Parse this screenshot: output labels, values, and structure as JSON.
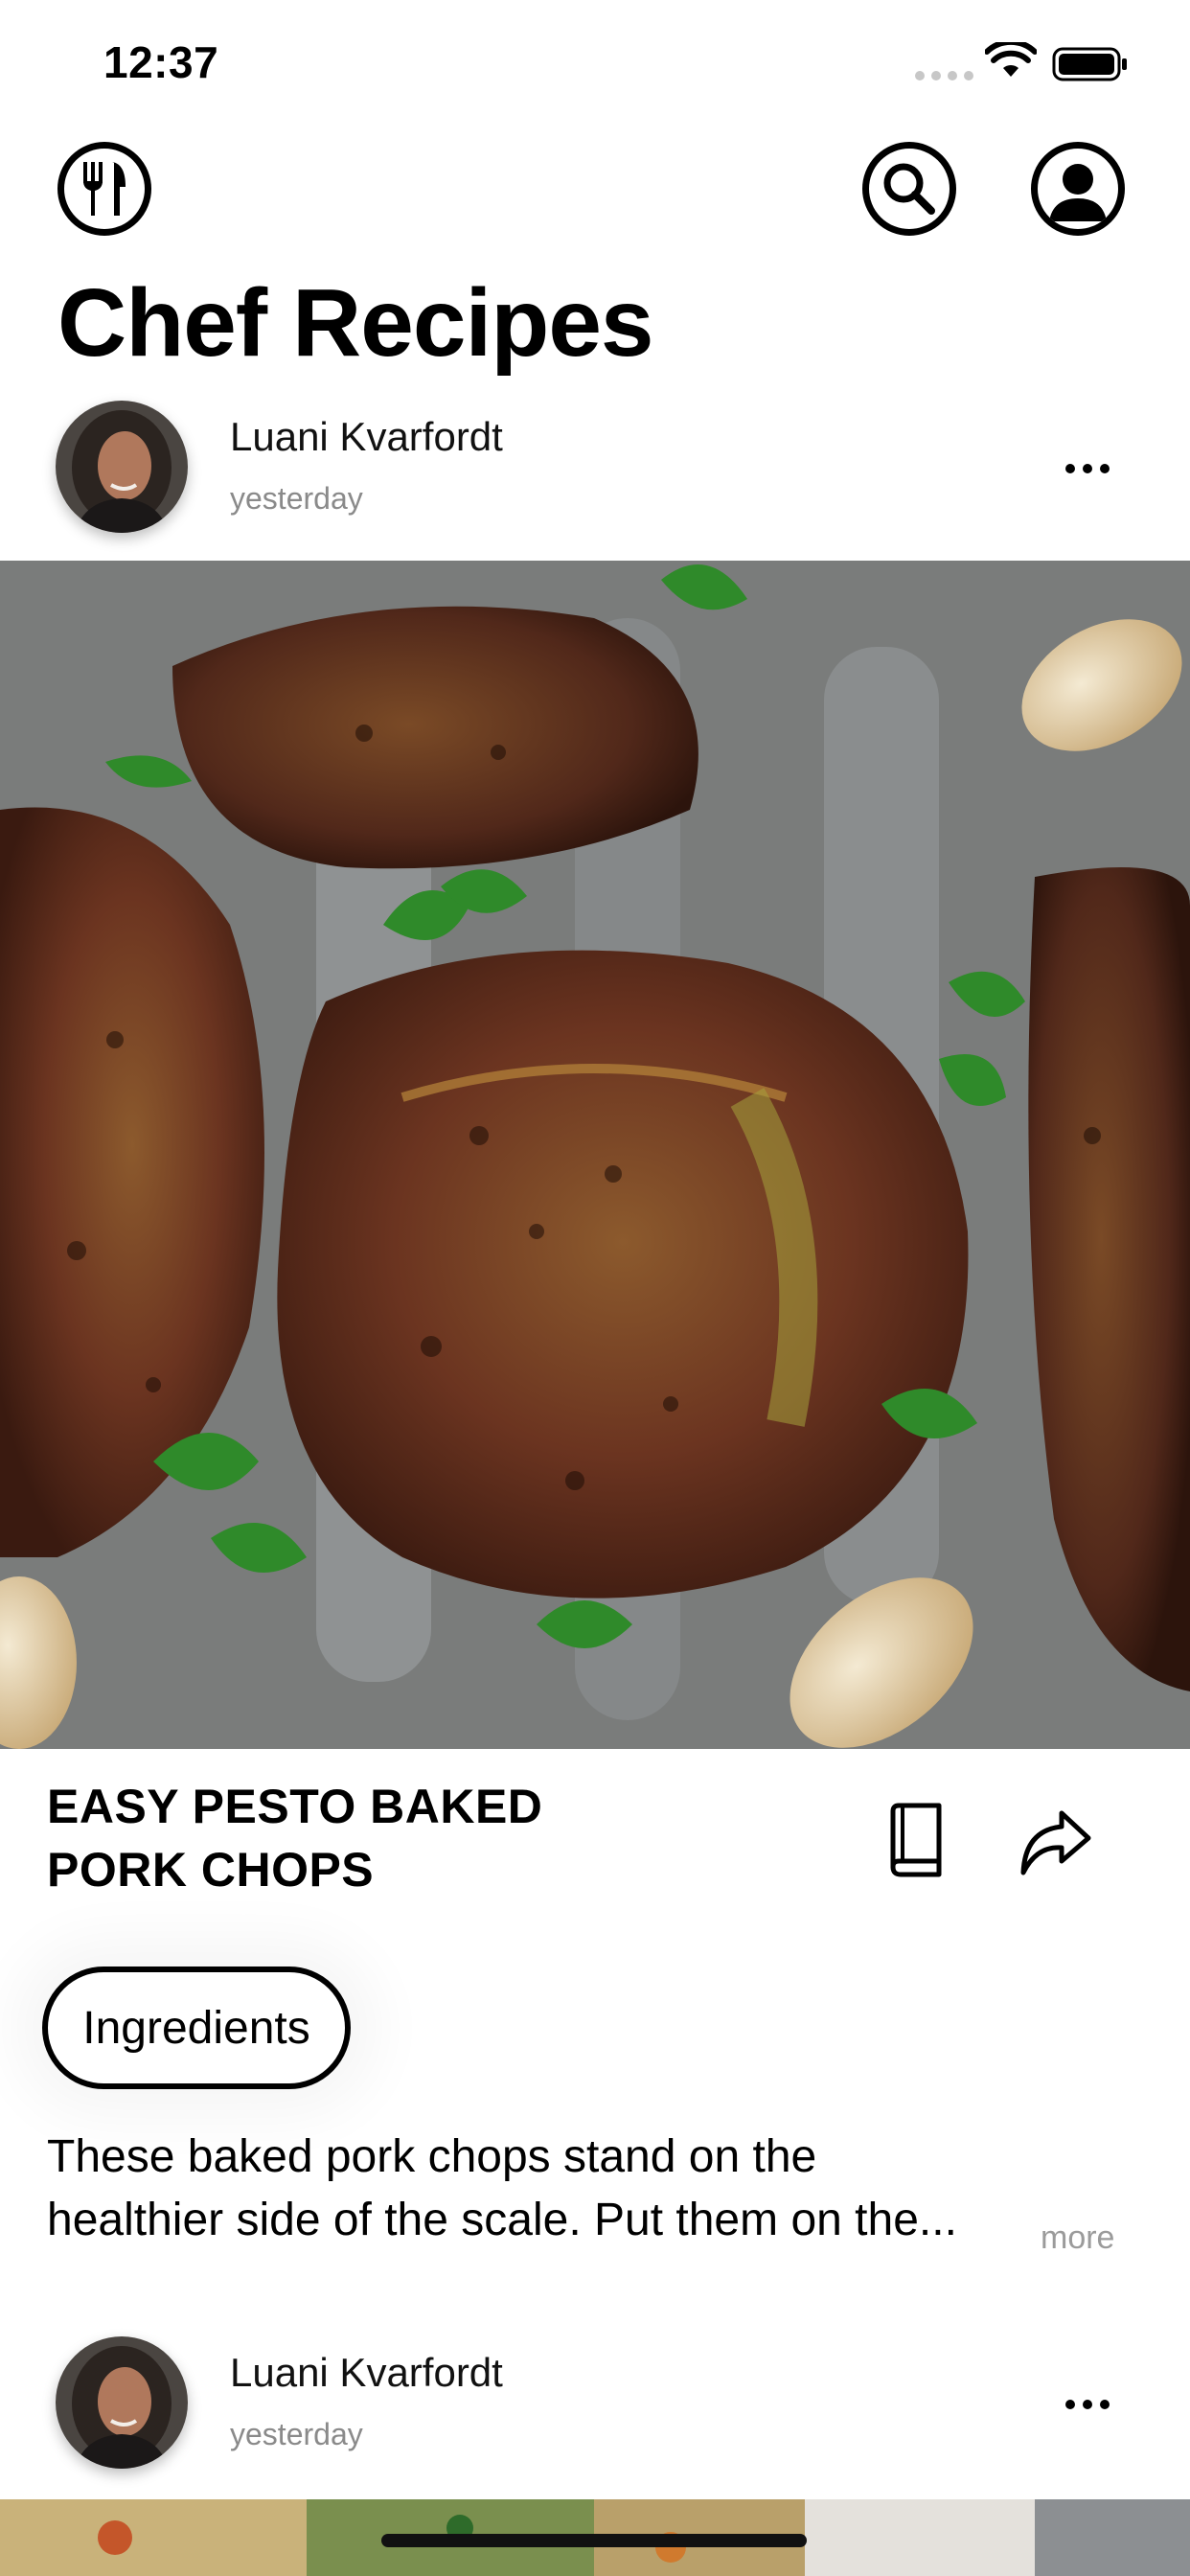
{
  "status_bar": {
    "time": "12:37",
    "icons": [
      "cellular-signal-icon",
      "wifi-icon",
      "battery-icon"
    ]
  },
  "header": {
    "app_icon": "fork-knife-icon",
    "search_icon": "search-icon",
    "profile_icon": "profile-icon",
    "title": "Chef Recipes"
  },
  "posts": [
    {
      "author": "Luani Kvarfordt",
      "time": "yesterday",
      "recipe_title_line1": "EASY PESTO BAKED",
      "recipe_title_line2": "PORK CHOPS",
      "ingredients_label": "Ingredients",
      "description_line1": "These baked pork chops stand on the",
      "description_line2": "healthier side of the scale. Put them on the...",
      "more_label": "more"
    },
    {
      "author": "Luani Kvarfordt",
      "time": "yesterday"
    }
  ],
  "colors": {
    "text_primary": "#000000",
    "text_secondary": "#8a8a8a",
    "more_link": "#9b9b9b",
    "background": "#ffffff"
  }
}
